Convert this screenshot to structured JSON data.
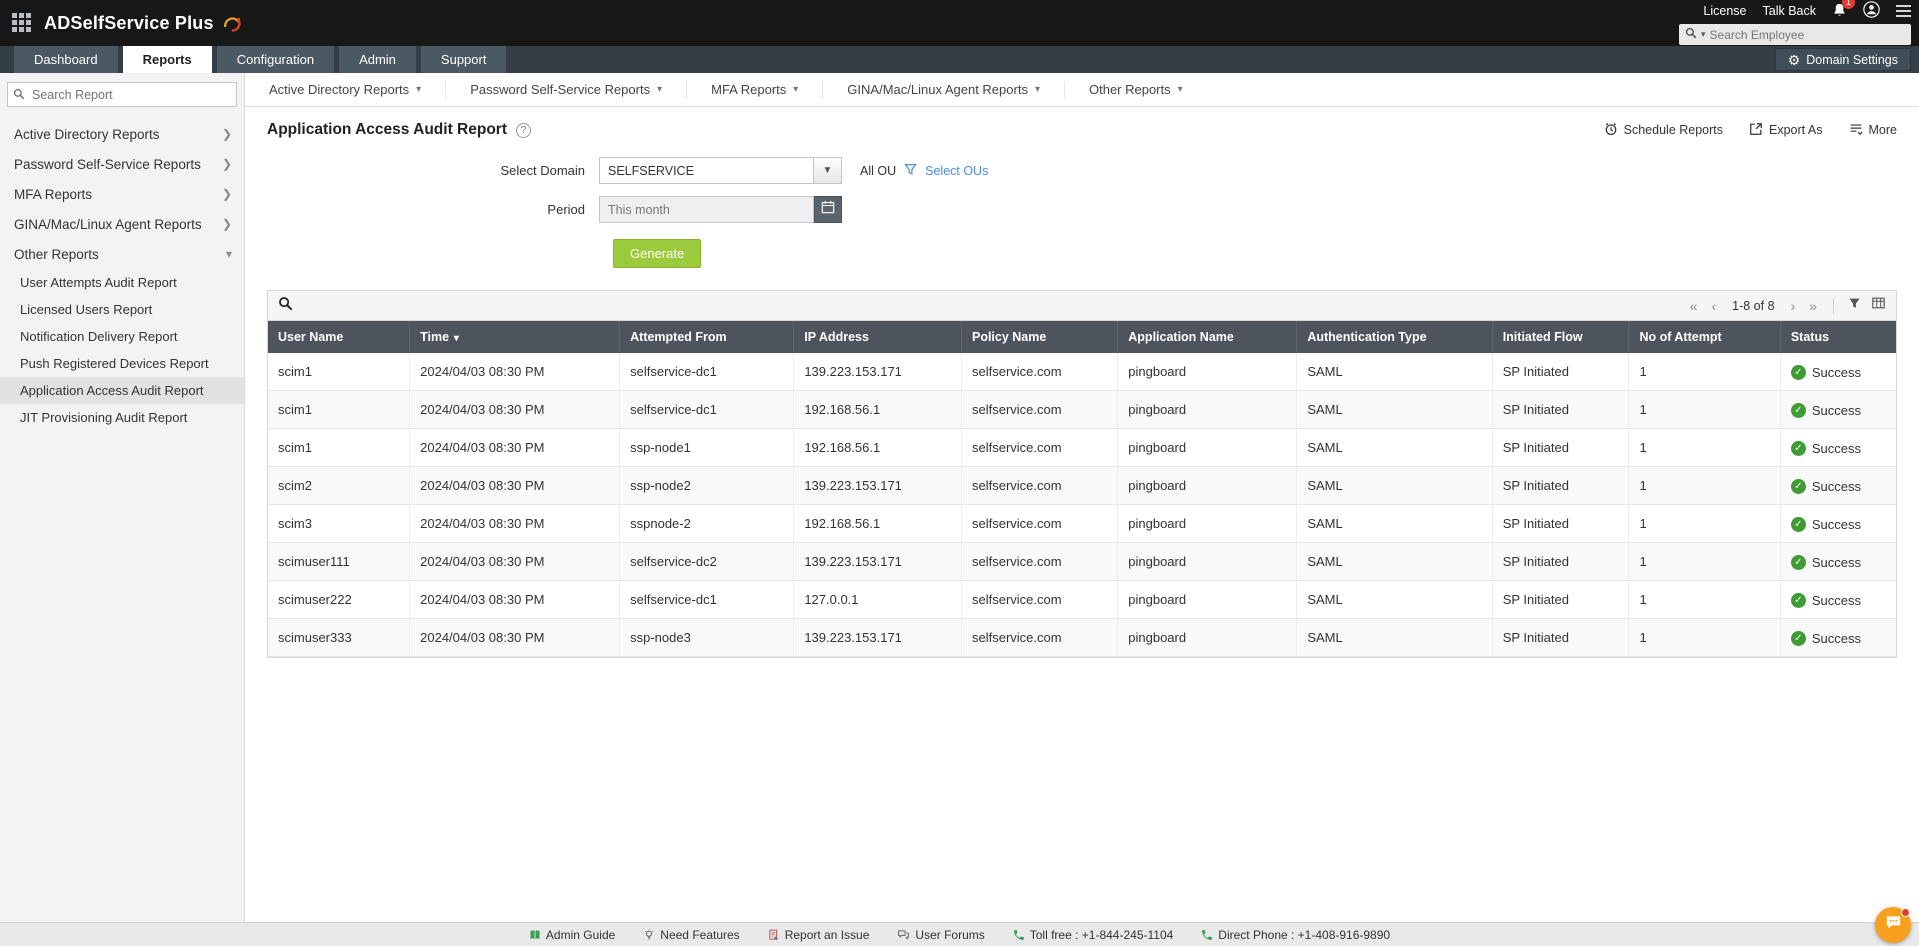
{
  "topbar": {
    "logo_text": "ADSelfService Plus",
    "license_label": "License",
    "talkback_label": "Talk Back",
    "notification_count": "1",
    "search_placeholder": "Search Employee"
  },
  "tabbar": {
    "tabs": [
      {
        "label": "Dashboard",
        "active": false
      },
      {
        "label": "Reports",
        "active": true
      },
      {
        "label": "Configuration",
        "active": false
      },
      {
        "label": "Admin",
        "active": false
      },
      {
        "label": "Support",
        "active": false
      }
    ],
    "domain_settings_label": "Domain Settings"
  },
  "sidebar": {
    "search_placeholder": "Search Report",
    "items": [
      {
        "label": "Active Directory Reports",
        "expanded": false
      },
      {
        "label": "Password Self-Service Reports",
        "expanded": false
      },
      {
        "label": "MFA Reports",
        "expanded": false
      },
      {
        "label": "GINA/Mac/Linux Agent Reports",
        "expanded": false
      },
      {
        "label": "Other Reports",
        "expanded": true,
        "children": [
          {
            "label": "User Attempts Audit Report",
            "selected": false
          },
          {
            "label": "Licensed Users Report",
            "selected": false
          },
          {
            "label": "Notification Delivery Report",
            "selected": false
          },
          {
            "label": "Push Registered Devices Report",
            "selected": false
          },
          {
            "label": "Application Access Audit Report",
            "selected": true
          },
          {
            "label": "JIT Provisioning Audit Report",
            "selected": false
          }
        ]
      }
    ]
  },
  "report_menu": [
    "Active Directory Reports",
    "Password Self-Service Reports",
    "MFA Reports",
    "GINA/Mac/Linux Agent Reports",
    "Other Reports"
  ],
  "page": {
    "title": "Application Access Audit Report",
    "actions": {
      "schedule_label": "Schedule Reports",
      "export_label": "Export As",
      "more_label": "More"
    }
  },
  "form": {
    "select_domain_label": "Select Domain",
    "domain_value": "SELFSERVICE",
    "all_ou_label": "All OU",
    "select_ous_label": "Select OUs",
    "period_label": "Period",
    "period_value": "This month",
    "generate_label": "Generate"
  },
  "table": {
    "pagination_range": "1-8 of 8",
    "sort_column": "Time",
    "columns": [
      "User Name",
      "Time",
      "Attempted From",
      "IP Address",
      "Policy Name",
      "Application Name",
      "Authentication Type",
      "Initiated Flow",
      "No of Attempt",
      "Status"
    ],
    "rows": [
      {
        "user": "scim1",
        "time": "2024/04/03 08:30 PM",
        "from": "selfservice-dc1",
        "ip": "139.223.153.171",
        "policy": "selfservice.com",
        "app": "pingboard",
        "auth": "SAML",
        "flow": "SP Initiated",
        "attempts": "1",
        "status": "Success"
      },
      {
        "user": "scim1",
        "time": "2024/04/03 08:30 PM",
        "from": "selfservice-dc1",
        "ip": "192.168.56.1",
        "policy": "selfservice.com",
        "app": "pingboard",
        "auth": "SAML",
        "flow": "SP Initiated",
        "attempts": "1",
        "status": "Success"
      },
      {
        "user": "scim1",
        "time": "2024/04/03 08:30 PM",
        "from": "ssp-node1",
        "ip": "192.168.56.1",
        "policy": "selfservice.com",
        "app": "pingboard",
        "auth": "SAML",
        "flow": "SP Initiated",
        "attempts": "1",
        "status": "Success"
      },
      {
        "user": "scim2",
        "time": "2024/04/03 08:30 PM",
        "from": "ssp-node2",
        "ip": "139.223.153.171",
        "policy": "selfservice.com",
        "app": "pingboard",
        "auth": "SAML",
        "flow": "SP Initiated",
        "attempts": "1",
        "status": "Success"
      },
      {
        "user": "scim3",
        "time": "2024/04/03 08:30 PM",
        "from": "sspnode-2",
        "ip": "192.168.56.1",
        "policy": "selfservice.com",
        "app": "pingboard",
        "auth": "SAML",
        "flow": "SP Initiated",
        "attempts": "1",
        "status": "Success"
      },
      {
        "user": "scimuser111",
        "time": "2024/04/03 08:30 PM",
        "from": "selfservice-dc2",
        "ip": "139.223.153.171",
        "policy": "selfservice.com",
        "app": "pingboard",
        "auth": "SAML",
        "flow": "SP Initiated",
        "attempts": "1",
        "status": "Success"
      },
      {
        "user": "scimuser222",
        "time": "2024/04/03 08:30 PM",
        "from": "selfservice-dc1",
        "ip": "127.0.0.1",
        "policy": "selfservice.com",
        "app": "pingboard",
        "auth": "SAML",
        "flow": "SP Initiated",
        "attempts": "1",
        "status": "Success"
      },
      {
        "user": "scimuser333",
        "time": "2024/04/03 08:30 PM",
        "from": "ssp-node3",
        "ip": "139.223.153.171",
        "policy": "selfservice.com",
        "app": "pingboard",
        "auth": "SAML",
        "flow": "SP Initiated",
        "attempts": "1",
        "status": "Success"
      }
    ]
  },
  "footer": {
    "items": [
      {
        "label": "Admin Guide",
        "icon": "guide-book-icon"
      },
      {
        "label": "Need Features",
        "icon": "bulb-icon"
      },
      {
        "label": "Report an Issue",
        "icon": "report-issue-icon"
      },
      {
        "label": "User Forums",
        "icon": "forums-icon"
      },
      {
        "label": "Toll free : +1-844-245-1104",
        "icon": "phone-icon"
      },
      {
        "label": "Direct Phone : +1-408-916-9890",
        "icon": "phone-icon"
      }
    ]
  },
  "colors": {
    "brand_green": "#9bcb3c",
    "link_blue": "#4a90d9",
    "success_green": "#3f9c35",
    "table_header": "#4d545c",
    "chat_orange": "#f7a01d"
  }
}
